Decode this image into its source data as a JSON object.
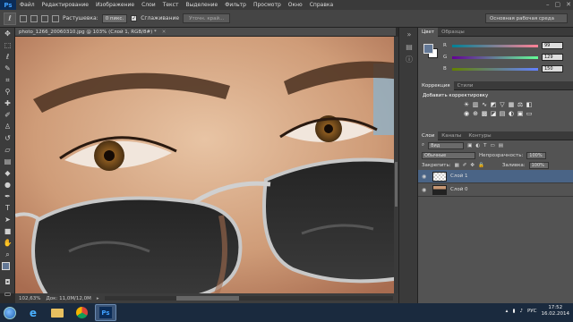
{
  "app": {
    "logo": "Ps"
  },
  "menu": [
    "Файл",
    "Редактирование",
    "Изображение",
    "Слои",
    "Текст",
    "Выделение",
    "Фильтр",
    "Просмотр",
    "Окно",
    "Справка"
  ],
  "window_controls": {
    "minimize": "–",
    "maximize": "▢",
    "close": "✕"
  },
  "options": {
    "feather_label": "Растушевка:",
    "feather_value": "0 пикс.",
    "antialias_label": "Сглаживание",
    "antialias_checked": true,
    "refine_button": "Уточн. край...",
    "workspace": "Основная рабочая среда"
  },
  "document": {
    "tab": "photo_1266_20060310.jpg @ 103% (Слой 1, RGB/8#) *",
    "zoom": "102,63%",
    "doc_size": "Док: 11,0M/12,0M"
  },
  "panels": {
    "color_tabs": [
      "Цвет",
      "Образцы"
    ],
    "color": {
      "r": 99,
      "g": 129,
      "b": 150,
      "fg_color": "#637896",
      "bg_color": "#ffffff"
    },
    "adjust_tabs": [
      "Коррекция",
      "Стили"
    ],
    "adjust_title": "Добавить корректировку",
    "layers_tabs": [
      "Слои",
      "Каналы",
      "Контуры"
    ],
    "kind": "Вид",
    "blend_mode": "Обычные",
    "opacity_label": "Непрозрачность:",
    "opacity_value": "100%",
    "lock_label": "Закрепить:",
    "fill_label": "Заливка:",
    "fill_value": "100%",
    "layers": [
      {
        "name": "Слой 1",
        "selected": true
      },
      {
        "name": "Слой 0",
        "selected": false
      }
    ]
  },
  "taskbar": {
    "language": "РУС",
    "time": "17:52",
    "date": "16.02.2014"
  }
}
